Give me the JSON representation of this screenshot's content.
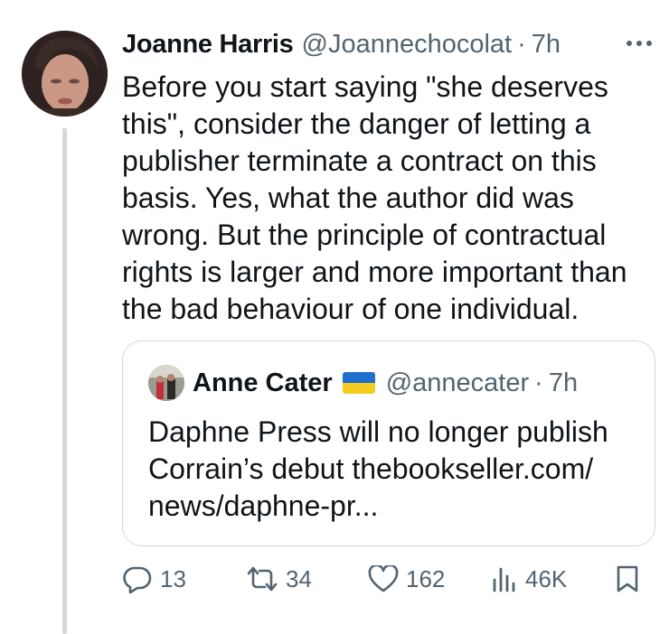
{
  "tweet": {
    "author_name": "Joanne Harris",
    "author_handle": "@Joannechocolat",
    "separator": "·",
    "time": "7h",
    "text": "Before you start saying \"she deserves this\", consider the danger of letting a publisher terminate a contract on this basis. Yes, what the author did was wrong. But the principle of contractual rights is larger and more important than the bad behaviour of one individual."
  },
  "quote": {
    "author_name": "Anne Cater",
    "author_handle": "@annecater",
    "separator": "·",
    "time": "7h",
    "text": "Daphne Press will no longer publish Corrain’s debut thebookseller.com/ news/daphne-pr...",
    "flag_colors": [
      "#1f6fd1",
      "#f6cb1f"
    ]
  },
  "actions": {
    "replies": "13",
    "reposts": "34",
    "likes": "162",
    "views": "46K"
  },
  "colors": {
    "text": "#0f1419",
    "secondary": "#536471",
    "border": "#cfd9de"
  },
  "icons": [
    "more-icon",
    "reply-icon",
    "repost-icon",
    "like-icon",
    "views-icon",
    "bookmark-icon"
  ]
}
